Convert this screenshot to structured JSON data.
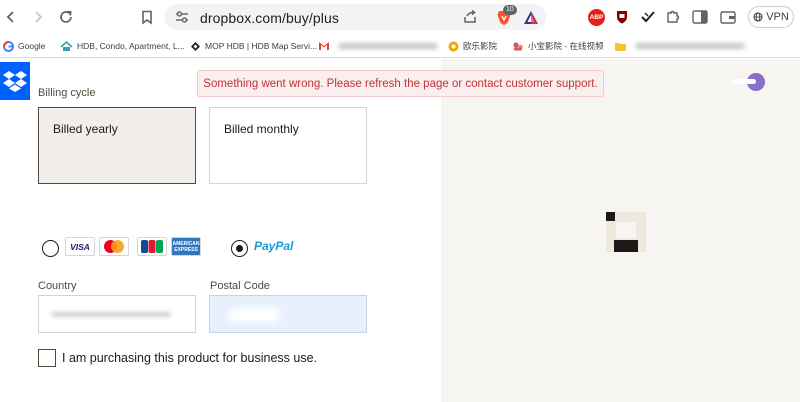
{
  "browser": {
    "url": "dropbox.com/buy/plus",
    "brave_badge": "10",
    "abp_label": "ABP",
    "vpn_label": "VPN",
    "bookmarks": [
      {
        "label": "Google",
        "icon": "google-icon",
        "color": "#4285f4"
      },
      {
        "label": "HDB, Condo, Apartment, L...",
        "icon": "house-icon",
        "color": "#2fa4a9"
      },
      {
        "label": "MOP HDB | HDB Map Servi...",
        "icon": "map-icon",
        "color": "#222222"
      },
      {
        "label": "",
        "icon": "gmail-icon",
        "color": "#ea4335"
      },
      {
        "label": "欧乐影院",
        "icon": "film-icon",
        "color": "#f0a500"
      },
      {
        "label": "小宝影院 - 在线视频",
        "icon": "video-icon",
        "color": "#d65a5a"
      },
      {
        "label": "",
        "icon": "folder-icon",
        "color": "#f4c430"
      }
    ]
  },
  "page": {
    "error_message": "Something went wrong. Please refresh the page or contact customer support.",
    "billing": {
      "label": "Billing cycle",
      "options": [
        {
          "label": "Billed yearly",
          "selected": true
        },
        {
          "label": "Billed monthly",
          "selected": false
        }
      ]
    },
    "payment": {
      "card_brands": [
        "VISA",
        "MasterCard",
        "JCB",
        "AMERICAN EXPRESS"
      ],
      "paypal_label": "PayPal",
      "selected_method": "paypal"
    },
    "country": {
      "label": "Country",
      "value": ""
    },
    "postal_code": {
      "label": "Postal Code",
      "value": ""
    },
    "business_checkbox": {
      "label": "I am purchasing this product for business use.",
      "checked": false
    }
  },
  "colors": {
    "accent": "#0061fe",
    "error": "#c0342f",
    "sidebar_bg": "#f7f5f2"
  }
}
